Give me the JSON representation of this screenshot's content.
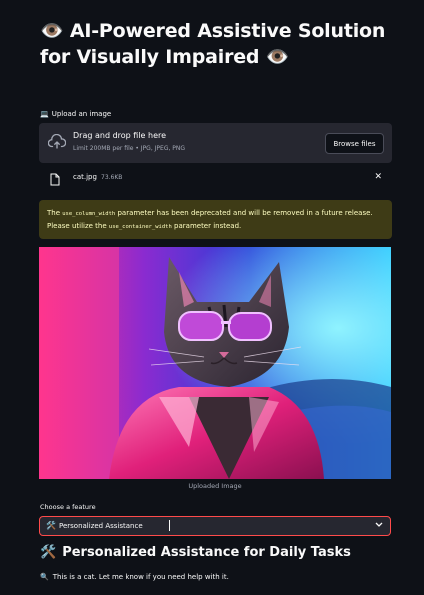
{
  "header": {
    "title": "👁️ AI-Powered Assistive Solution for Visually Impaired 👁️"
  },
  "uploader": {
    "label_icon": "laptop-icon",
    "label": "Upload an image",
    "drop_title": "Drag and drop file here",
    "drop_hint": "Limit 200MB per file • JPG, JPEG, PNG",
    "browse_label": "Browse files",
    "file": {
      "name": "cat.jpg",
      "size": "73.6KB"
    }
  },
  "warning": {
    "part1": "The ",
    "code1": "use_column_width",
    "part2": " parameter has been deprecated and will be removed in a future release. Please utilize the ",
    "code2": "use_container_width",
    "part3": " parameter instead."
  },
  "image": {
    "caption": "Uploaded Image"
  },
  "feature": {
    "label": "Choose a feature",
    "icon": "🛠️",
    "selected": "Personalized Assistance"
  },
  "result": {
    "heading_icon": "🛠️",
    "heading": "Personalized Assistance for Daily Tasks",
    "text_icon": "🔍",
    "text": "This is a cat. Let me know if you need help with it."
  },
  "colors": {
    "background": "#0e1117",
    "panel": "#262730",
    "accent": "#ff4b4b",
    "warning_bg": "#3e3b16",
    "warning_text": "#ffffc2"
  }
}
